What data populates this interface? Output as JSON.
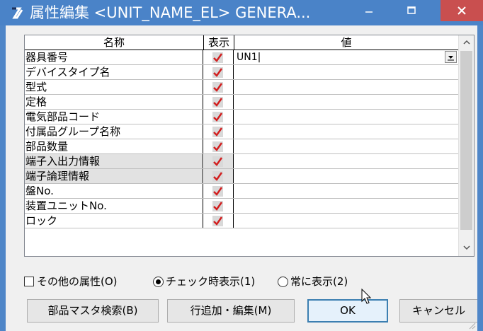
{
  "window": {
    "title": "属性編集 <UNIT_NAME_EL> GENERA...",
    "icon": "app-logo-icon",
    "minimize_label": "−",
    "maximize_label": "□",
    "close_label": "✕"
  },
  "grid": {
    "headers": {
      "name": "名称",
      "show": "表示",
      "value": "値"
    },
    "rows": [
      {
        "name": "器具番号",
        "checked": true,
        "value": "UN1|",
        "gray": false
      },
      {
        "name": "デバイスタイプ名",
        "checked": true,
        "value": "",
        "gray": false
      },
      {
        "name": "型式",
        "checked": true,
        "value": "",
        "gray": false
      },
      {
        "name": "定格",
        "checked": true,
        "value": "",
        "gray": false
      },
      {
        "name": "電気部品コード",
        "checked": true,
        "value": "",
        "gray": false
      },
      {
        "name": "付属品グループ名称",
        "checked": true,
        "value": "",
        "gray": false
      },
      {
        "name": "部品数量",
        "checked": true,
        "value": "",
        "gray": false
      },
      {
        "name": "端子入出力情報",
        "checked": true,
        "value": "",
        "gray": true
      },
      {
        "name": "端子論理情報",
        "checked": true,
        "value": "",
        "gray": true
      },
      {
        "name": "盤No.",
        "checked": true,
        "value": "",
        "gray": false
      },
      {
        "name": "装置ユニットNo.",
        "checked": true,
        "value": "",
        "gray": false
      },
      {
        "name": "ロック",
        "checked": true,
        "value": "",
        "gray": false
      }
    ],
    "scrollbar": {
      "up_icon": "chevron-up-icon",
      "down_icon": "chevron-down-icon"
    }
  },
  "options": {
    "other_attrs": {
      "label": "その他の属性(O)",
      "checked": false
    },
    "show_when_checked": {
      "label": "チェック時表示(1)",
      "selected": true
    },
    "always_show": {
      "label": "常に表示(2)",
      "selected": false
    }
  },
  "buttons": {
    "parts_master_search": "部品マスタ検索(B)",
    "add_edit_row": "行追加・編集(M)",
    "ok": "OK",
    "cancel": "キャンセル"
  },
  "colors": {
    "titlebar": "#4a83c8",
    "close_button": "#c94f4f",
    "check_mark": "#d21f1f"
  }
}
